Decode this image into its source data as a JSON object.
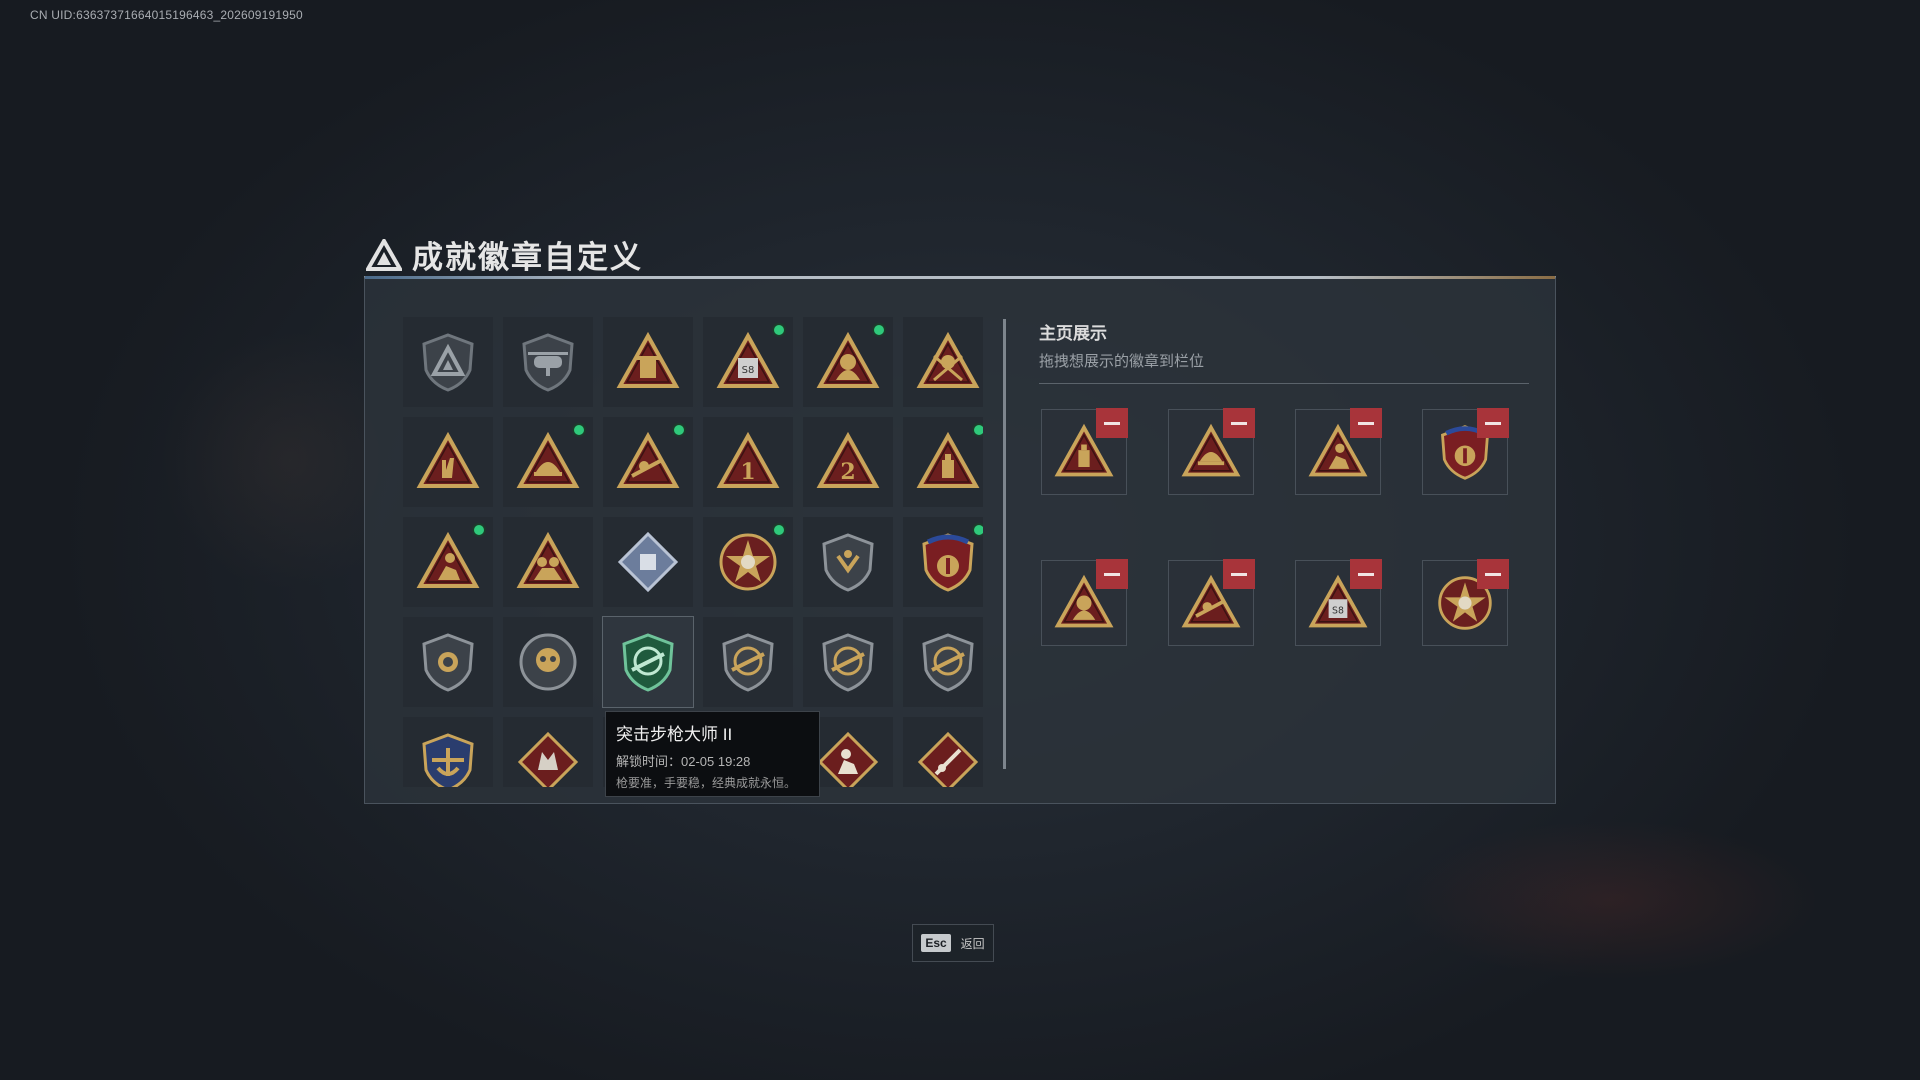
{
  "uid_text": "CN UID:63637371664015196463_202609191950",
  "header": {
    "title": "成就徽章自定义",
    "icon": "triangle-logo-icon"
  },
  "colors": {
    "gold": "#c9a45a",
    "dark_red": "#6b1e1e",
    "green_dot": "#2fc97b",
    "minus_red": "#a8343a",
    "shield_gray": "#5d646b"
  },
  "badges": [
    {
      "icon": "shield-triangle-badge-icon",
      "new": false
    },
    {
      "icon": "helicopter-shield-badge-icon",
      "new": false
    },
    {
      "icon": "fortress-triangle-badge-icon",
      "new": false
    },
    {
      "icon": "s8-triangle-badge-icon",
      "new": true
    },
    {
      "icon": "hooded-triangle-badge-icon",
      "new": true
    },
    {
      "icon": "crossed-soldier-triangle-badge-icon",
      "new": false
    },
    {
      "icon": "hand-sign-triangle-badge-icon",
      "new": false
    },
    {
      "icon": "helmet-triangle-badge-icon",
      "new": true
    },
    {
      "icon": "sniper-triangle-badge-icon",
      "new": true
    },
    {
      "icon": "number-1-triangle-badge-icon",
      "new": false
    },
    {
      "icon": "number-2-triangle-badge-icon",
      "new": false
    },
    {
      "icon": "bottle-triangle-badge-icon",
      "new": true
    },
    {
      "icon": "runner-triangle-badge-icon",
      "new": true
    },
    {
      "icon": "squad-triangle-badge-icon",
      "new": false
    },
    {
      "icon": "crate-diamond-badge-icon",
      "new": false
    },
    {
      "icon": "star-skull-badge-icon",
      "new": true
    },
    {
      "icon": "emblem-shield-badge-icon",
      "new": false
    },
    {
      "icon": "stars-crest-badge-icon",
      "new": true
    },
    {
      "icon": "lion-shield-badge-icon",
      "new": false
    },
    {
      "icon": "skull-round-badge-icon",
      "new": false
    },
    {
      "icon": "rifle-master-shield-badge-icon",
      "new": false,
      "selected": true
    },
    {
      "icon": "rifle-shield-badge-icon",
      "new": false
    },
    {
      "icon": "rifle-shield-badge-icon",
      "new": false
    },
    {
      "icon": "rifle-shield-badge-icon",
      "new": false
    },
    {
      "icon": "gold-anchor-shield-badge-icon",
      "new": false
    },
    {
      "icon": "wolf-diamond-badge-icon",
      "new": false
    },
    {
      "icon": "hidden-badge",
      "new": false
    },
    {
      "icon": "hidden-badge",
      "new": false
    },
    {
      "icon": "kneeling-diamond-badge-icon",
      "new": false
    },
    {
      "icon": "weapon-diamond-badge-icon",
      "new": false
    }
  ],
  "tooltip": {
    "title": "突击步枪大师 II",
    "time": "解锁时间：02-05 19:28",
    "desc": "枪要准，手要稳，经典成就永恒。"
  },
  "showcase": {
    "title": "主页展示",
    "subtitle": "拖拽想展示的徽章到栏位",
    "slots": [
      "bottle-triangle-badge-icon",
      "helmet-triangle-badge-icon",
      "runner-triangle-badge-icon",
      "stars-crest-badge-icon",
      "hooded-triangle-badge-icon",
      "sniper-triangle-badge-icon",
      "s8-triangle-badge-icon",
      "star-skull-badge-icon"
    ]
  },
  "footer": {
    "esc_key": "Esc",
    "esc_label": "返回"
  }
}
